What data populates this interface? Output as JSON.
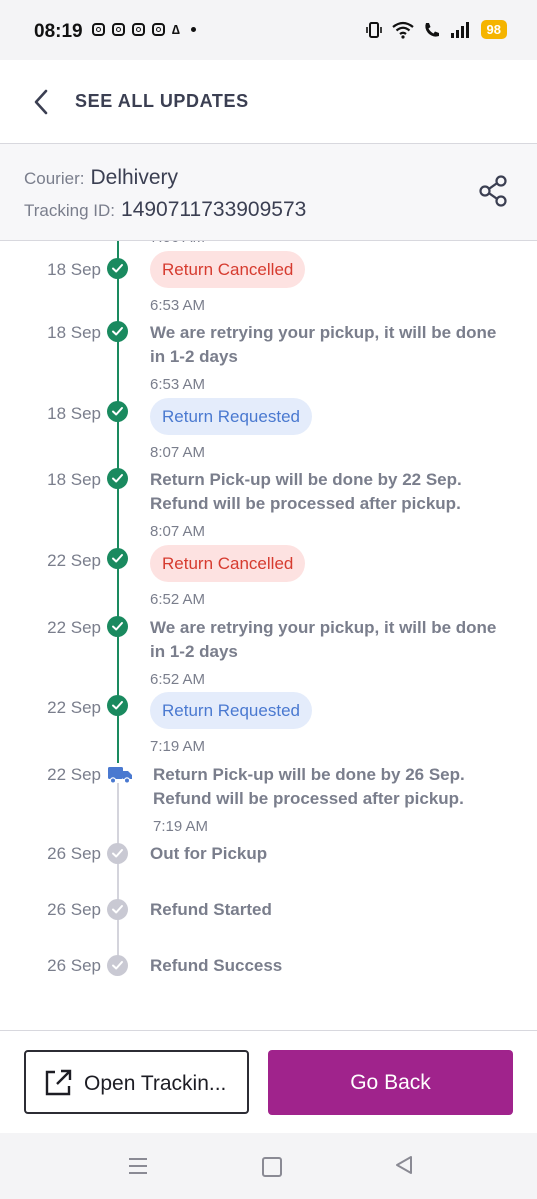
{
  "status_bar": {
    "time": "08:19",
    "battery": "98",
    "icons": [
      "instagram-icon",
      "instagram-icon",
      "instagram-icon",
      "instagram-icon",
      "a-icon",
      "dot-icon",
      "vibrate-icon",
      "wifi-icon",
      "wifi-call-icon",
      "signal-icon",
      "battery-icon"
    ]
  },
  "header": {
    "title": "SEE ALL UPDATES",
    "back_icon": "chevron-left-icon"
  },
  "courier": {
    "courier_label": "Courier:",
    "courier_value": "Delhivery",
    "tracking_label": "Tracking ID:",
    "tracking_value": "1490711733909573",
    "share_icon": "share-icon"
  },
  "timeline": {
    "events": [
      {
        "date": "18 Sep",
        "badge": "Return Cancelled",
        "time": "6:53 AM"
      },
      {
        "date": "18 Sep",
        "message": "We are retrying your pickup, it will be done in 1-2 days",
        "time": "6:53 AM"
      },
      {
        "date": "18 Sep",
        "badge": "Return Requested",
        "time": "8:07 AM"
      },
      {
        "date": "18 Sep",
        "message": "Return Pick-up will be done by 22 Sep. Refund will be processed after pickup.",
        "time": "8:07 AM"
      },
      {
        "date": "22 Sep",
        "badge": "Return Cancelled",
        "time": "6:52 AM"
      },
      {
        "date": "22 Sep",
        "message": "We are retrying your pickup, it will be done in 1-2 days",
        "time": "6:52 AM"
      },
      {
        "date": "22 Sep",
        "badge": "Return Requested",
        "time": "7:19 AM"
      },
      {
        "date": "22 Sep",
        "message": "Return Pick-up will be done by 26 Sep. Refund will be processed after pickup.",
        "time": "7:19 AM"
      },
      {
        "date": "26 Sep",
        "message": "Out for Pickup"
      },
      {
        "date": "26 Sep",
        "message": "Refund Started"
      },
      {
        "date": "26 Sep",
        "message": "Refund Success"
      }
    ],
    "colors": {
      "done": "#1a8a5f",
      "pending": "#c9c9d3",
      "current": "#4a79d0"
    }
  },
  "footer": {
    "open_tracking_label": "Open Trackin...",
    "go_back_label": "Go Back",
    "accent": "#a0238c"
  },
  "nav_bar": {
    "icons": [
      "menu-icon",
      "home-icon",
      "back-icon"
    ]
  }
}
